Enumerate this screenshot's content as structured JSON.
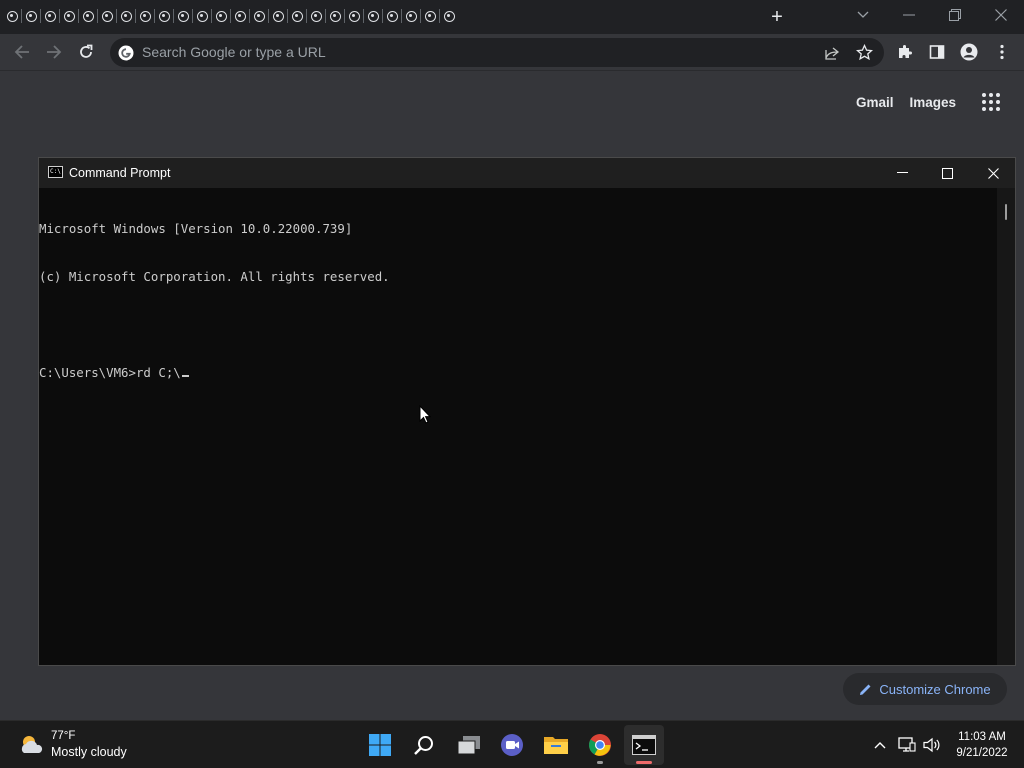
{
  "browser": {
    "tab_count": 24,
    "tab_icon": "loading-tab-icon",
    "new_tab_label": "+",
    "omnibox_placeholder": "Search Google or type a URL",
    "ntp": {
      "gmail": "Gmail",
      "images": "Images",
      "customize": "Customize Chrome"
    }
  },
  "cmd": {
    "title": "Command Prompt",
    "lines": [
      "Microsoft Windows [Version 10.0.22000.739]",
      "(c) Microsoft Corporation. All rights reserved.",
      "",
      "C:\\Users\\VM6>rd C;\\"
    ]
  },
  "taskbar": {
    "weather_temp": "77°F",
    "weather_desc": "Mostly cloudy",
    "time": "11:03 AM",
    "date": "9/21/2022"
  },
  "colors": {
    "accent_link": "#8ab4f8",
    "active_indicator": "#ef6b6b"
  }
}
